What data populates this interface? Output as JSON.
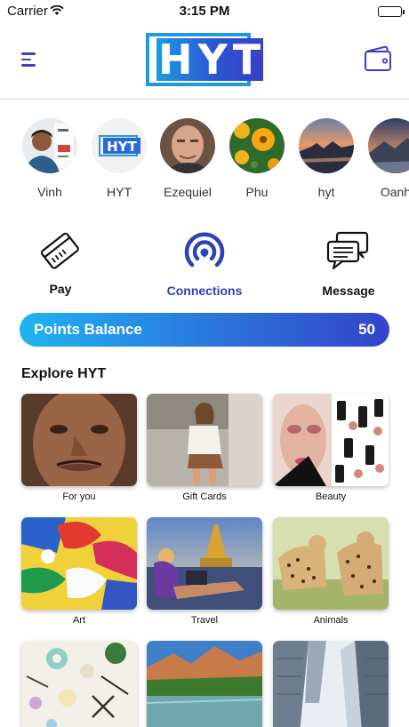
{
  "status_bar": {
    "carrier": "Carrier",
    "time": "3:15 PM"
  },
  "nav": {
    "logo_text": "HYT",
    "menu_icon": "hamburger-menu-icon",
    "wallet_icon": "wallet-icon",
    "accent_color": "#3a3fc4"
  },
  "stories": [
    {
      "name": "Vinh"
    },
    {
      "name": "HYT"
    },
    {
      "name": "Ezequiel"
    },
    {
      "name": "Phu"
    },
    {
      "name": "hyt"
    },
    {
      "name": "Oanh"
    }
  ],
  "actions": [
    {
      "label": "Pay",
      "icon": "credit-card-icon"
    },
    {
      "label": "Connections",
      "icon": "broadcast-icon",
      "active": true
    },
    {
      "label": "Message",
      "icon": "chat-bubbles-icon"
    }
  ],
  "points": {
    "label": "Points Balance",
    "value": "50"
  },
  "explore": {
    "title": "Explore HYT",
    "tiles": [
      {
        "caption": "For you"
      },
      {
        "caption": "Gift Cards"
      },
      {
        "caption": "Beauty"
      },
      {
        "caption": "Art"
      },
      {
        "caption": "Travel"
      },
      {
        "caption": "Animals"
      },
      {
        "caption": ""
      },
      {
        "caption": ""
      },
      {
        "caption": ""
      }
    ]
  }
}
